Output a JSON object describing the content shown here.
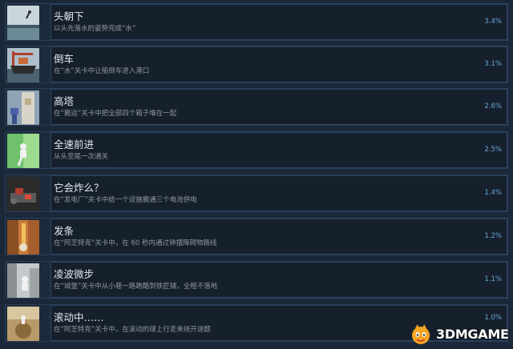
{
  "achievements": [
    {
      "title": "头朝下",
      "desc": "以头先落水的姿势完成“水”",
      "percent": "3.4%",
      "thumb": "dive-icon"
    },
    {
      "title": "倒车",
      "desc": "在“水”关卡中让船倒车进入港口",
      "percent": "3.1%",
      "thumb": "ship-icon"
    },
    {
      "title": "高塔",
      "desc": "在“搬运”关卡中把全部四个箱子堆在一起",
      "percent": "2.6%",
      "thumb": "tower-icon"
    },
    {
      "title": "全速前进",
      "desc": "从头至尾一次通关",
      "percent": "2.5%",
      "thumb": "runner-icon"
    },
    {
      "title": "它会炸么？",
      "desc": "在“发电厂”关卡中给一个设施搬通三个电池供电",
      "percent": "1.4%",
      "thumb": "bomb-icon"
    },
    {
      "title": "发条",
      "desc": "在“阿芝特克”关卡中，在 60 秒内通过钟摆障碍物路线",
      "percent": "1.2%",
      "thumb": "clockwork-icon"
    },
    {
      "title": "凌波微步",
      "desc": "在“城堡”关卡中从小巷一路跑酷到铁匠铺，全程不落地",
      "percent": "1.1%",
      "thumb": "parkour-icon"
    },
    {
      "title": "滚动中……",
      "desc": "在“阿芝特克”关卡中，在滚动的球上行走来绕开谜题",
      "percent": "1.0%",
      "thumb": "ball-icon"
    }
  ],
  "watermark": {
    "text": "3DMGAME",
    "logo": "3dm-logo-icon"
  },
  "colors": {
    "background": "#1b2838",
    "percent": "#67a8d6",
    "title": "#e4e8ec",
    "desc": "#8f98a0"
  }
}
